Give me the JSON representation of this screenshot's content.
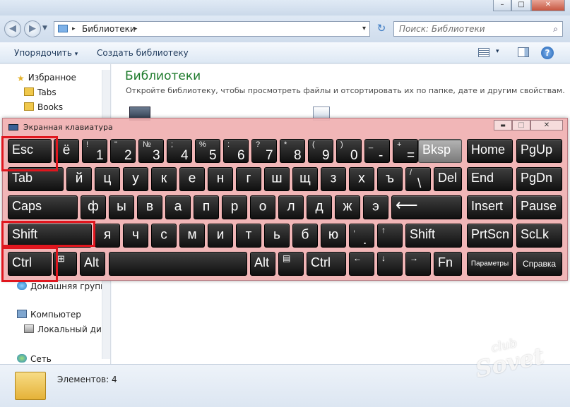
{
  "explorer": {
    "title_bar": {
      "minimize": "–",
      "maximize": "□",
      "close": "✕"
    },
    "address": {
      "path": "Библиотеки",
      "separator": "▸",
      "dropdown": "▾",
      "refresh": "↻"
    },
    "search": {
      "placeholder": "Поиск: Библиотеки"
    },
    "toolbar": {
      "organize": "Упорядочить",
      "organize_arrow": "▾",
      "create_library": "Создать библиотеку",
      "view_arrow": "▾",
      "help": "?"
    },
    "nav": {
      "favorites": "Избранное",
      "tabs": "Tabs",
      "books": "Books",
      "homegroup": "Домашняя групп",
      "computer": "Компьютер",
      "local_disk": "Локальный дис",
      "network": "Сеть"
    },
    "content": {
      "heading": "Библиотеки",
      "description": "Откройте библиотеку, чтобы просмотреть файлы и отсортировать их по папке, дате и другим свойствам."
    },
    "status": {
      "items": "Элементов: 4"
    }
  },
  "osk": {
    "title": "Экранная клавиатура",
    "controls": {
      "minimize": "▬",
      "maximize": "□",
      "close": "✕"
    },
    "keys": {
      "esc": "Esc",
      "row1": [
        [
          "ё",
          ""
        ],
        [
          "!",
          "1"
        ],
        [
          "\"",
          "2"
        ],
        [
          "№",
          "3"
        ],
        [
          ";",
          "4"
        ],
        [
          "%",
          "5"
        ],
        [
          ":",
          "6"
        ],
        [
          "?",
          "7"
        ],
        [
          "*",
          "8"
        ],
        [
          "(",
          "9"
        ],
        [
          ")",
          "0"
        ],
        [
          "_",
          "-"
        ],
        [
          "+",
          "="
        ]
      ],
      "bksp": "Bksp",
      "home": "Home",
      "pgup": "PgUp",
      "tab": "Tab",
      "row2": [
        "й",
        "ц",
        "у",
        "к",
        "е",
        "н",
        "г",
        "ш",
        "щ",
        "з",
        "х",
        "ъ"
      ],
      "backslash_top": "/",
      "backslash": "\\",
      "del": "Del",
      "end": "End",
      "pgdn": "PgDn",
      "caps": "Caps",
      "row3": [
        "ф",
        "ы",
        "в",
        "а",
        "п",
        "р",
        "о",
        "л",
        "д",
        "ж",
        "э"
      ],
      "enter": "⟵",
      "insert": "Insert",
      "pause": "Pause",
      "shift": "Shift",
      "row4": [
        "я",
        "ч",
        "с",
        "м",
        "и",
        "т",
        "ь",
        "б",
        "ю"
      ],
      "period_top": ",",
      "period": ".",
      "up": "↑",
      "shift_right": "Shift",
      "prtscn": "PrtScn",
      "sclk": "ScLk",
      "ctrl": "Ctrl",
      "win": "⊞",
      "alt": "Alt",
      "alt_right": "Alt",
      "menu": "▤",
      "ctrl_right": "Ctrl",
      "left": "←",
      "down": "↓",
      "right": "→",
      "fn": "Fn",
      "options": "Параметры",
      "help": "Справка"
    }
  },
  "watermark": {
    "line1": "club",
    "line2": "Sovet"
  }
}
